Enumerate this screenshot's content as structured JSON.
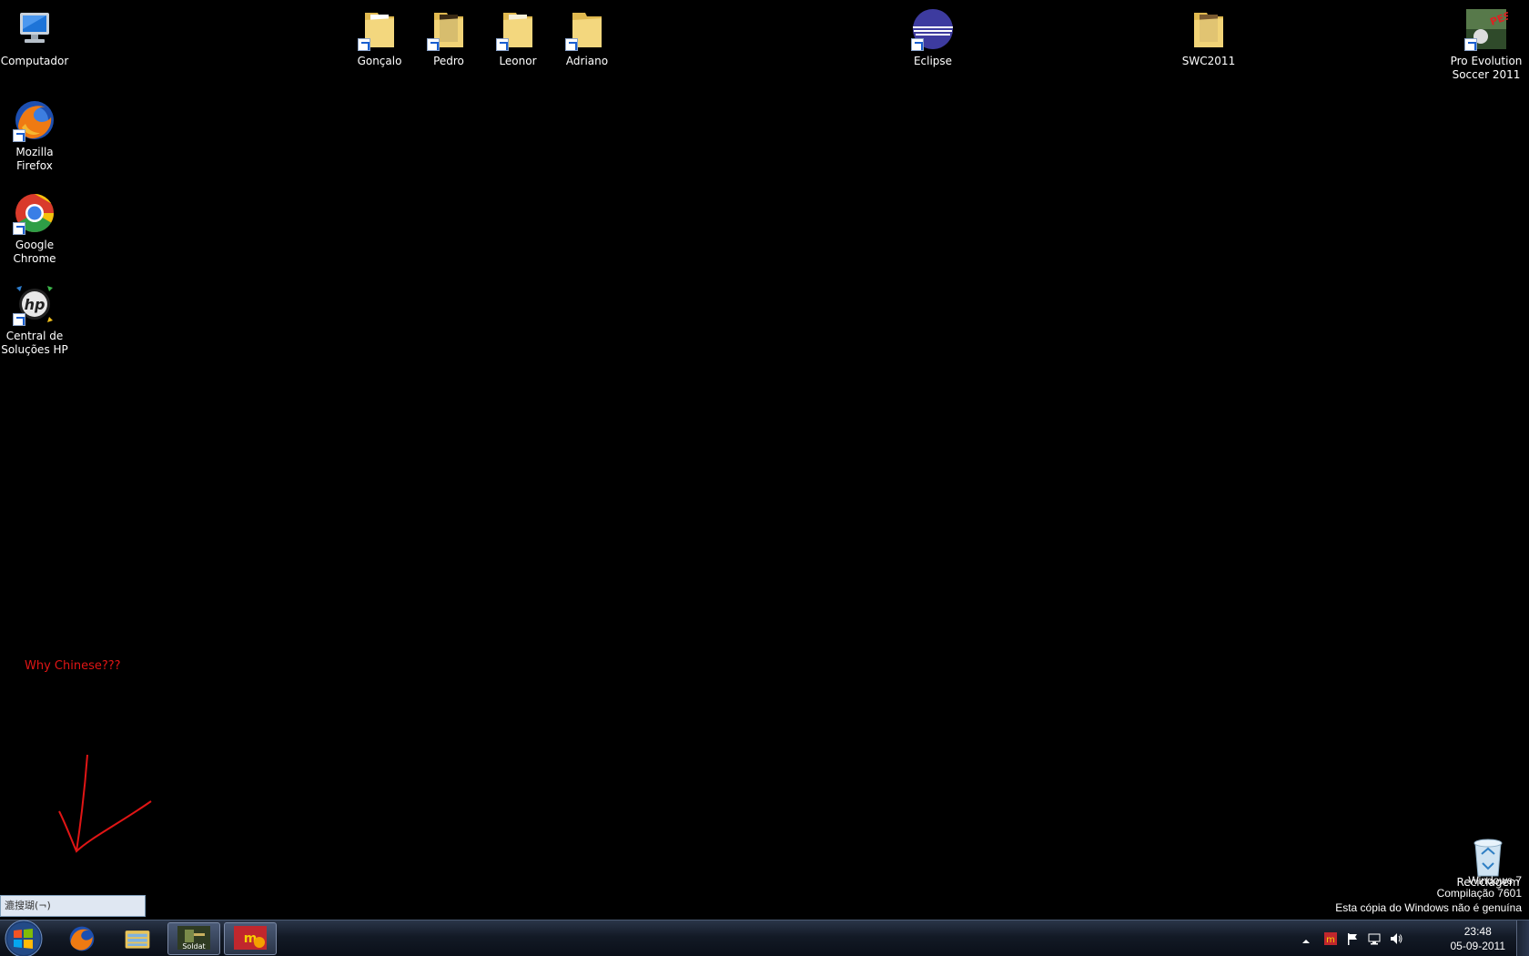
{
  "desktop_icons": [
    {
      "label": "Computador",
      "icon": "computer-icon"
    },
    {
      "label": "Mozilla Firefox",
      "icon": "firefox-icon"
    },
    {
      "label": "Google Chrome",
      "icon": "chrome-icon"
    },
    {
      "label": "Central de Soluções HP",
      "icon": "hp-icon"
    },
    {
      "label": "Gonçalo",
      "icon": "folder-icon"
    },
    {
      "label": "Pedro",
      "icon": "folder-icon"
    },
    {
      "label": "Leonor",
      "icon": "folder-icon"
    },
    {
      "label": "Adriano",
      "icon": "folder-icon"
    },
    {
      "label": "Eclipse",
      "icon": "eclipse-icon"
    },
    {
      "label": "SWC2011",
      "icon": "folder-icon"
    },
    {
      "label": "Pro Evolution Soccer 2011",
      "icon": "pes-icon"
    },
    {
      "label": "Reciclagem",
      "icon": "recycle-bin-icon"
    }
  ],
  "annotation": {
    "text": "Why Chinese???",
    "color": "#e01515"
  },
  "watermark": {
    "line1": "Windows 7",
    "line2": "Compilação 7601",
    "line3": "Esta cópia do Windows não é genuína"
  },
  "ime_bar": {
    "text": "漉搜瑚(¬)"
  },
  "taskbar": {
    "pinned": [
      {
        "name": "firefox-icon"
      },
      {
        "name": "explorer-icon"
      },
      {
        "name": "soldat-icon",
        "label": "Soldat"
      },
      {
        "name": "mirc-icon"
      }
    ]
  },
  "clock": {
    "time": "23:48",
    "date": "05-09-2011"
  },
  "colors": {
    "desktop": "#000000",
    "taskbar": "#131a26",
    "accent": "#e01515"
  }
}
